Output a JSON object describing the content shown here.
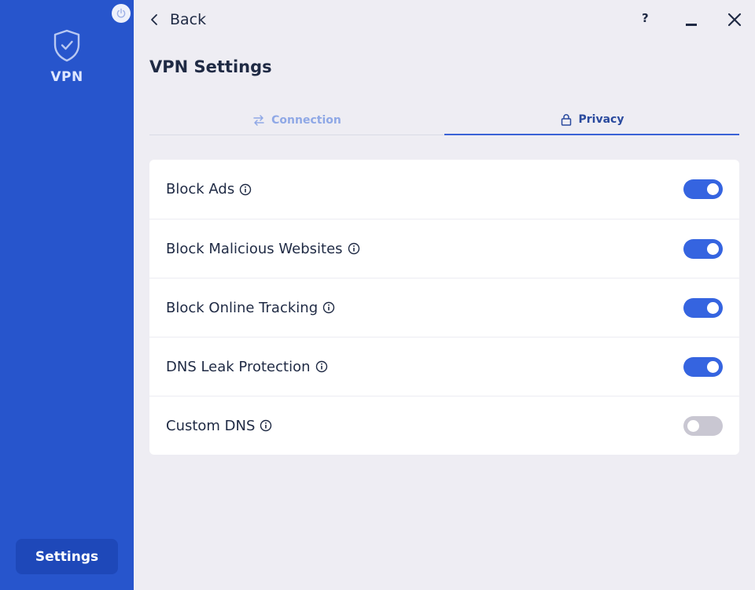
{
  "sidebar": {
    "brand_label": "VPN",
    "settings_label": "Settings",
    "power_icon": "power-icon",
    "shield_icon": "shield-check-icon"
  },
  "topbar": {
    "back_label": "Back",
    "help_label": "?"
  },
  "page": {
    "title": "VPN Settings"
  },
  "tabs": [
    {
      "label": "Connection",
      "icon": "swap-arrows-icon",
      "active": false
    },
    {
      "label": "Privacy",
      "icon": "lock-icon",
      "active": true
    }
  ],
  "settings": [
    {
      "label": "Block Ads",
      "enabled": true
    },
    {
      "label": "Block Malicious Websites",
      "enabled": true
    },
    {
      "label": "Block Online Tracking",
      "enabled": true
    },
    {
      "label": "DNS Leak Protection",
      "enabled": true
    },
    {
      "label": "Custom DNS",
      "enabled": false
    }
  ],
  "colors": {
    "sidebar": "#2755cc",
    "accent": "#3564e0",
    "toggle_off": "#c9c7d2",
    "background": "#eeedf3"
  }
}
